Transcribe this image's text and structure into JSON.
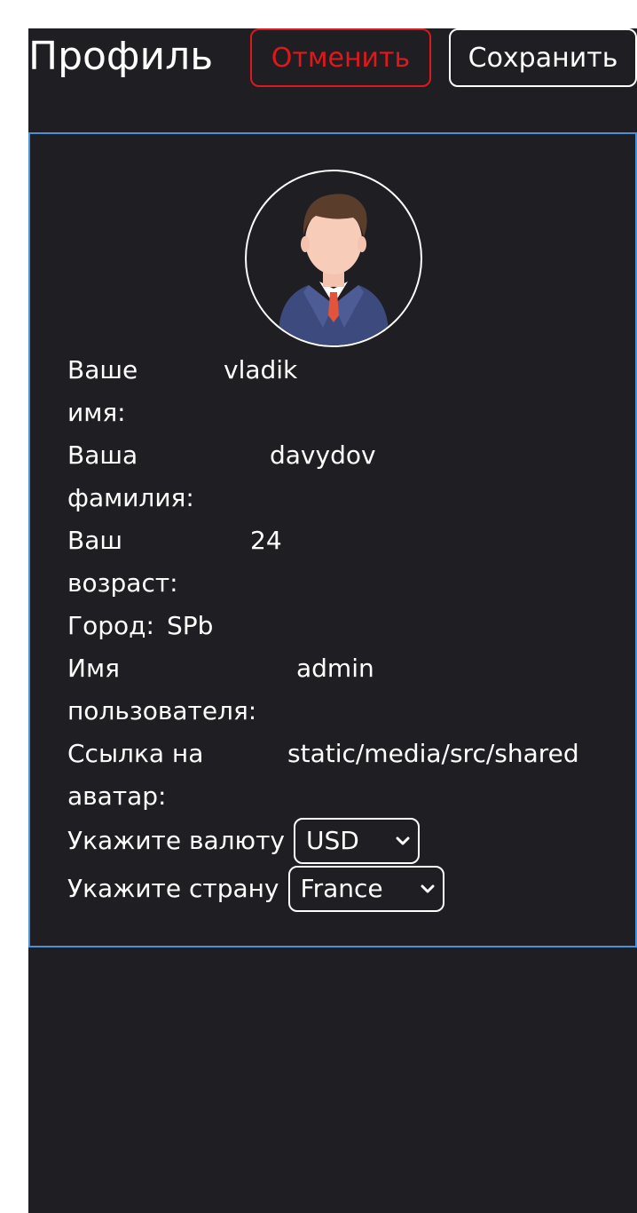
{
  "header": {
    "title": "Профиль",
    "cancel_label": "Отменить",
    "save_label": "Сохранить"
  },
  "avatar": {
    "icon": "user-avatar-icon"
  },
  "fields": {
    "first_name": {
      "label": "Ваше\nимя:",
      "value": "vladik"
    },
    "last_name": {
      "label": "Ваша\nфамилия:",
      "value": "davydov"
    },
    "age": {
      "label": "Ваш\nвозраст:",
      "value": "24"
    },
    "city": {
      "label": "Город:",
      "value": "SPb"
    },
    "username": {
      "label": "Имя\nпользователя:",
      "value": "admin"
    },
    "avatar_link": {
      "label": "Ссылка на\nаватар:",
      "value": "static/media/src/shared"
    }
  },
  "currency": {
    "label": "Укажите валюту",
    "selected": "USD"
  },
  "country": {
    "label": "Укажите страну",
    "selected": "France"
  },
  "colors": {
    "background": "#1f1e22",
    "accent_cancel": "#e0181b",
    "card_border": "#4a90d6"
  }
}
